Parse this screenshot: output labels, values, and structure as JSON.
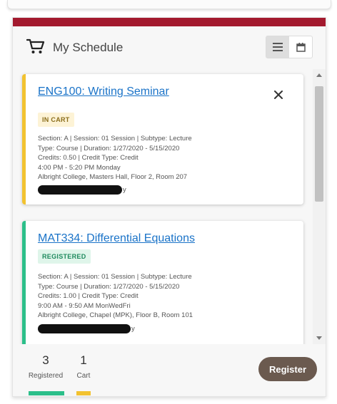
{
  "colors": {
    "accent": "#a3192e",
    "cart_status": "#f2c230",
    "registered_status": "#2cbf8a",
    "link": "#1a73c8",
    "register_button": "#6b5a4f"
  },
  "header": {
    "icon": "shopping-cart-icon",
    "title": "My Schedule",
    "view_toggle": [
      {
        "icon": "list-view-icon",
        "active": true
      },
      {
        "icon": "calendar-view-icon",
        "active": false
      }
    ]
  },
  "courses": [
    {
      "title": "ENG100: Writing Seminar",
      "status": "IN CART",
      "details": [
        "Section: A | Session: 01 Session | Subtype: Lecture",
        "Type: Course | Duration: 1/27/2020 - 5/15/2020",
        "Credits: 0.50 | Credit Type: Credit",
        "4:00 PM - 5:20 PM Monday",
        "Albright College, Masters Hall, Floor 2, Room 207"
      ],
      "redacted_tail": "y",
      "removable": true
    },
    {
      "title": "MAT334: Differential Equations",
      "status": "REGISTERED",
      "details": [
        "Section: A | Session: 01 Session | Subtype: Lecture",
        "Type: Course | Duration: 1/27/2020 - 5/15/2020",
        "Credits: 1.00 | Credit Type: Credit",
        "9:00 AM - 9:50 AM MonWedFri",
        "Albright College, Chapel (MPK), Floor B, Room 101"
      ],
      "redacted_tail": "y",
      "removable": false
    }
  ],
  "footer": {
    "registered_count": "3",
    "registered_label": "Registered",
    "cart_count": "1",
    "cart_label": "Cart",
    "register_label": "Register"
  }
}
